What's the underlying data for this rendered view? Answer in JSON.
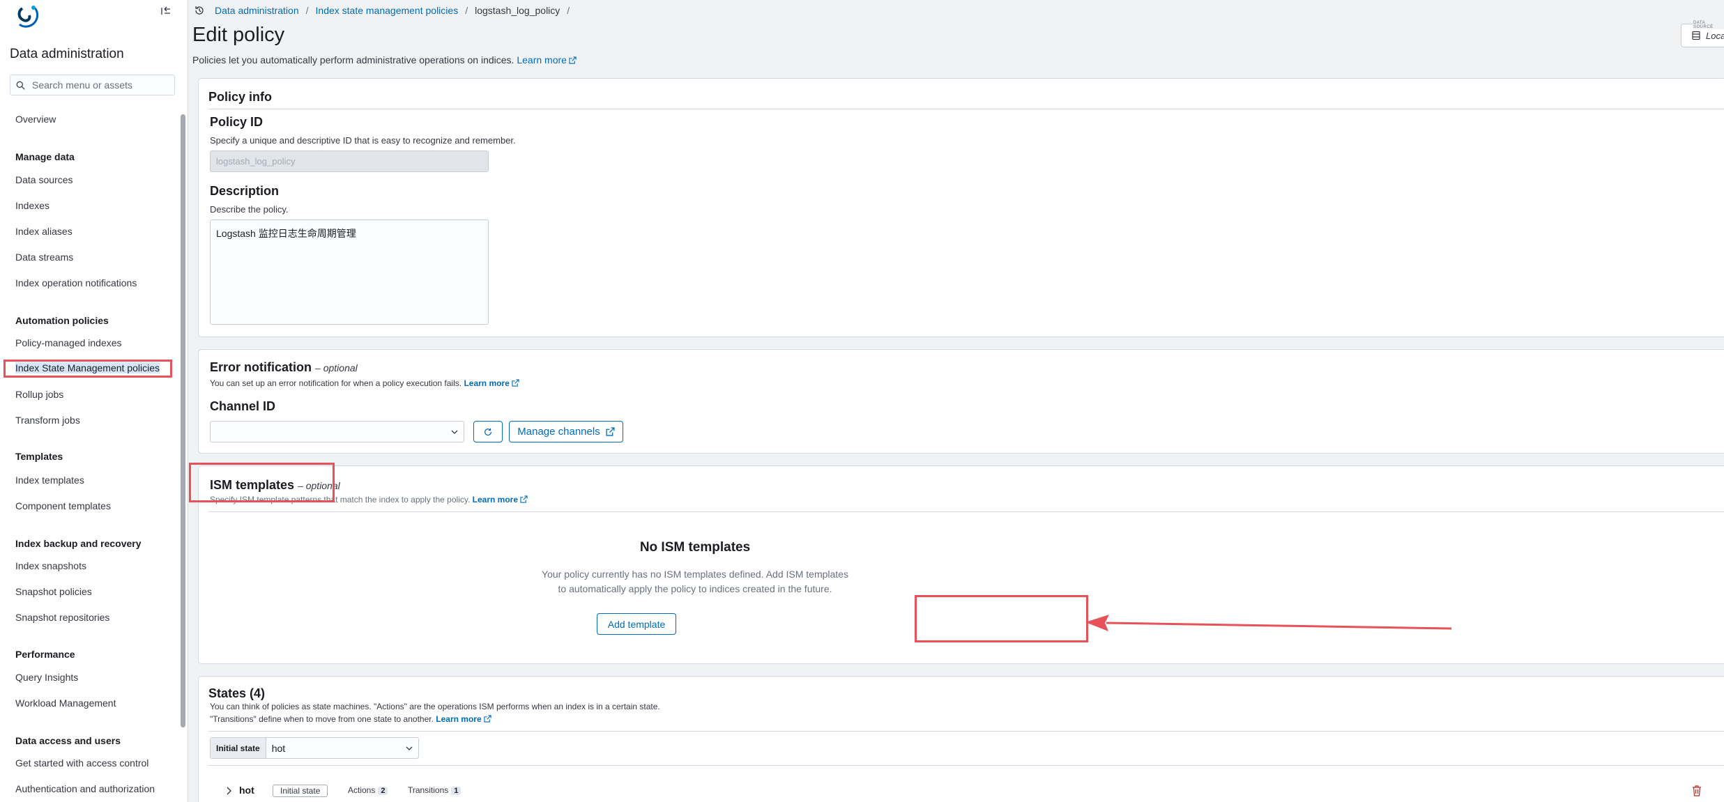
{
  "sidebar": {
    "title": "Data administration",
    "search_placeholder": "Search menu or assets",
    "overview": "Overview",
    "sections": {
      "manage_data": {
        "heading": "Manage data",
        "items": [
          "Data sources",
          "Indexes",
          "Index aliases",
          "Data streams",
          "Index operation notifications"
        ]
      },
      "automation": {
        "heading": "Automation policies",
        "items": [
          "Policy-managed indexes",
          "Index State Management policies",
          "Rollup jobs",
          "Transform jobs"
        ]
      },
      "templates": {
        "heading": "Templates",
        "items": [
          "Index templates",
          "Component templates"
        ]
      },
      "backup": {
        "heading": "Index backup and recovery",
        "items": [
          "Index snapshots",
          "Snapshot policies",
          "Snapshot repositories"
        ]
      },
      "performance": {
        "heading": "Performance",
        "items": [
          "Query Insights",
          "Workload Management"
        ]
      },
      "access": {
        "heading": "Data access and users",
        "items": [
          "Get started with access control",
          "Authentication and authorization"
        ]
      }
    }
  },
  "breadcrumbs": [
    "Data administration",
    "Index state management policies",
    "logstash_log_policy"
  ],
  "header": {
    "title": "Edit policy",
    "description": "Policies let you automatically perform administrative operations on indices.",
    "learn_more": "Learn more",
    "data_source_label": "DATA SOURCE",
    "data_source_value": "Local"
  },
  "policy_info": {
    "title": "Policy info",
    "id_label": "Policy ID",
    "id_help": "Specify a unique and descriptive ID that is easy to recognize and remember.",
    "id_value": "logstash_log_policy",
    "desc_label": "Description",
    "desc_help": "Describe the policy.",
    "desc_value": "Logstash 监控日志生命周期管理"
  },
  "error_notification": {
    "title": "Error notification",
    "optional": "– optional",
    "help": "You can set up an error notification for when a policy execution fails.",
    "learn_more": "Learn more",
    "channel_label": "Channel ID",
    "manage_channels": "Manage channels"
  },
  "ism_templates": {
    "title": "ISM templates",
    "optional": "– optional",
    "help": "Specify ISM template patterns that match the index to apply the policy.",
    "learn_more": "Learn more",
    "empty_title": "No ISM templates",
    "empty_line1": "Your policy currently has no ISM templates defined. Add ISM templates",
    "empty_line2": "to automatically apply the policy to indices created in the future.",
    "add_button": "Add template"
  },
  "states": {
    "title": "States (4)",
    "help_line1": "You can think of policies as state machines. \"Actions\" are the operations ISM performs when an index is in a certain state.",
    "help_line2": "\"Transitions\" define when to move from one state to another.",
    "learn_more": "Learn more",
    "initial_state_label": "Initial state",
    "initial_state_value": "hot",
    "row": {
      "name": "hot",
      "initial_pill": "Initial state",
      "actions_label": "Actions",
      "actions_count": "2",
      "transitions_label": "Transitions",
      "transitions_count": "1"
    }
  },
  "colors": {
    "link": "#006bb8",
    "annotation": "#e7515a",
    "selected_bg": "#d6e7fb"
  }
}
